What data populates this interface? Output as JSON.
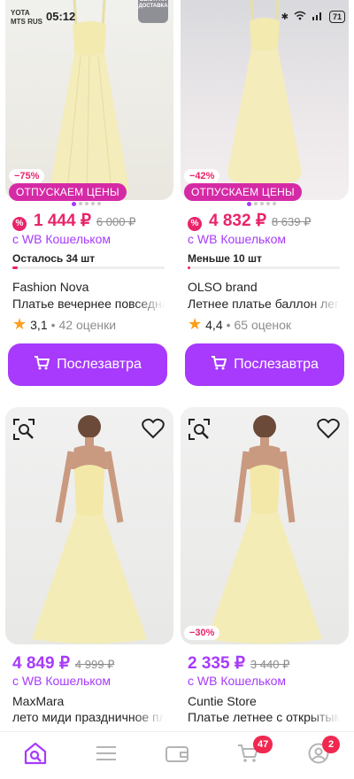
{
  "status_bar": {
    "carrier1": "YOTA",
    "carrier2": "MTS RUS",
    "time": "05:12",
    "battery": "71"
  },
  "products": [
    {
      "sale_percent": "−75%",
      "promo": "ОТПУСКАЕМ ЦЕНЫ",
      "price": "1 444 ₽",
      "old_price": "6 000 ₽",
      "wallet_text": "с WB Кошельком",
      "stock_text": "Осталось 34 шт",
      "brand": "Fashion Nova",
      "title": "Платье вечернее повседневное",
      "rating": "3,1",
      "reviews": "42 оценки",
      "button": "Послезавтра",
      "express_label": "БЫСТРАЯ ДОСТАВКА"
    },
    {
      "sale_percent": "−42%",
      "promo": "ОТПУСКАЕМ ЦЕНЫ",
      "price": "4 832 ₽",
      "old_price": "8 639 ₽",
      "wallet_text": "с WB Кошельком",
      "stock_text": "Меньше 10 шт",
      "brand": "OLSO brand",
      "title": "Летнее платье баллон легкое",
      "rating": "4,4",
      "reviews": "65 оценок",
      "button": "Послезавтра"
    },
    {
      "price": "4 849 ₽",
      "old_price": "4 999 ₽",
      "wallet_text": "с WB Кошельком",
      "brand": "MaxMara",
      "title": "лето миди праздничное платье"
    },
    {
      "sale_percent": "−30%",
      "price": "2 335 ₽",
      "old_price": "3 440 ₽",
      "wallet_text": "с WB Кошельком",
      "brand": "Cuntie Store",
      "title": "Платье летнее с открытыми плечами"
    }
  ],
  "nav": {
    "cart_count": "47",
    "profile_count": "2"
  },
  "colors": {
    "accent": "#a73afd",
    "sale": "#e8246a",
    "promo": "#d52aa6"
  }
}
